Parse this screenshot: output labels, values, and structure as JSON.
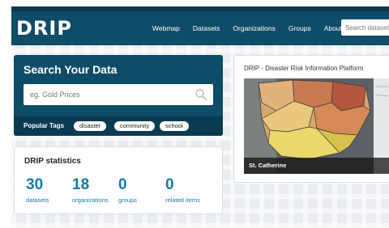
{
  "header": {
    "logo": "DRIP",
    "nav": [
      "Webmap",
      "Datasets",
      "Organizations",
      "Groups",
      "About"
    ],
    "search_placeholder": "Search datasets"
  },
  "search": {
    "title": "Search Your Data",
    "placeholder": "eg. Gold Prices",
    "tags_label": "Popular Tags",
    "tags": [
      "disaster",
      "community",
      "school"
    ]
  },
  "stats": {
    "title": "DRIP statistics",
    "items": [
      {
        "value": "30",
        "label": "datasets"
      },
      {
        "value": "18",
        "label": "organizations"
      },
      {
        "value": "0",
        "label": "groups"
      },
      {
        "value": "0",
        "label": "related items"
      }
    ]
  },
  "featured": {
    "title": "DRIP - Disaster Risk Information Platform",
    "caption": "St. Catherine"
  },
  "colors": {
    "navbar": "#0f4c67",
    "accent": "#1678a8"
  },
  "icons": {
    "search": "search-icon"
  }
}
